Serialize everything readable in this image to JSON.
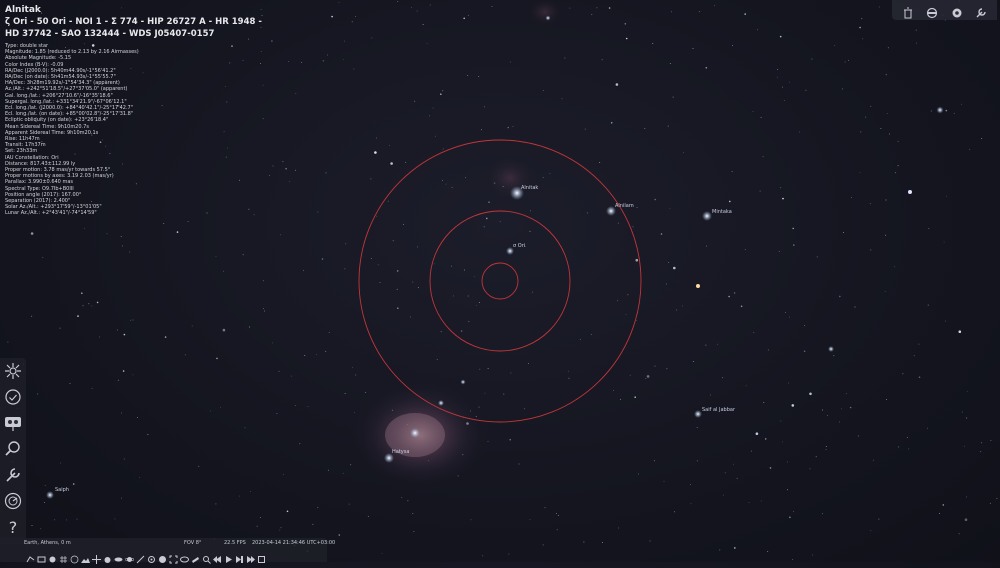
{
  "object": {
    "title": "Alnitak",
    "names": "ζ Ori - 50 Ori - NOI 1 - Σ 774 - HIP 26727 A - HR 1948 - HD 37742 - SAO 132444 - WDS J05407-0157",
    "details": [
      "Type: double star",
      "Magnitude: 1.85 (reduced to 2.13 by 2.16 Airmasses)",
      "Absolute Magnitude: -5.15",
      "Color Index (B-V): -0.09",
      "RA/Dec (J2000.0): 5h40m44.90s/-1°56'41.2\"",
      "RA/Dec (on date): 5h41m54.93s/-1°55'55.7\"",
      "HA/Dec: 3h28m19.92s/-1°54'34.3\" (apparent)",
      "Az./Alt.: +242°51'18.5\"/+27°37'05.0\" (apparent)",
      "Gal. long./lat.: +206°27'10.6\"/-16°35'18.6\"",
      "Supergal. long./lat.: +331°34'21.9\"/-67°06'12.1\"",
      "Ecl. long./lat. (J2000.0): +84°40'42.1\"/-25°17'42.7\"",
      "Ecl. long./lat. (on date): +85°00'02.8\"/-25°17'31.8\"",
      "Ecliptic obliquity (on date): +23°26'18.4\"",
      "Mean Sidereal Time: 9h10m20.7s",
      "Apparent Sidereal Time: 9h10m20.1s",
      "Rise: 11h47m",
      "Transit: 17h37m",
      "Set: 23h33m",
      "IAU Constellation: Ori",
      "Distance: 817.43±112.99 ly",
      "Proper motion: 3.78 mas/yr towards 57.5°",
      "Proper motions by axes: 3.19 2.03 (mas/yr)",
      "Parallax: 3.990±0.640 mas",
      "Spectral Type: O9.7Ib+B0III",
      "Position angle (2017): 167.00°",
      "Separation (2017): 2.400\"",
      "Solar Az./Alt.: +293°17'59\"/-13°01'05\"",
      "Lunar Az./Alt.: +2°43'41\"/-74°14'59\""
    ]
  },
  "sky_labels": {
    "alnitak": "Alnitak",
    "alnilam": "Alnilam",
    "mintaka": "Mintaka",
    "sigma_ori": "σ Ori",
    "saif": "Saif al Jabbar",
    "hatysa": "Hatysa",
    "saiph": "Saiph"
  },
  "status_bar": {
    "location": "Earth, Athens, 0 m",
    "fov": "FOV 8°",
    "fps": "22.5 FPS",
    "datetime": "2023-04-14 21:34:46 UTC+03:00"
  },
  "left_toolbar": [
    "sky-and-viewing-options-icon",
    "date-time-icon",
    "location-icon",
    "search-icon",
    "configuration-icon",
    "astronomical-calculations-icon",
    "help-icon"
  ],
  "top_right_toolbar": [
    "trash-icon",
    "ocular-icon",
    "settings-icon",
    "wrench-icon"
  ],
  "colors": {
    "sky": "#14151f",
    "reticle": "#c0363a",
    "toolbar_bg": "#1e1f28",
    "text": "#e8e8ec",
    "label": "#c8cde0"
  }
}
